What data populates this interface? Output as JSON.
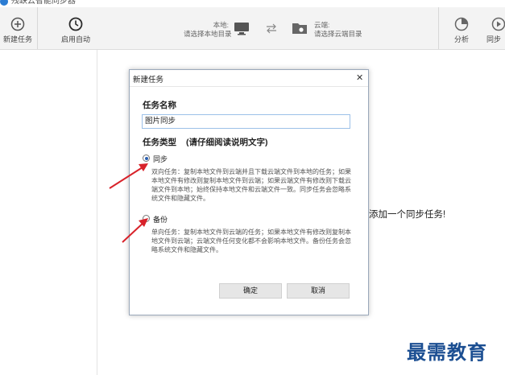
{
  "window": {
    "title": "残缺云智能同步器"
  },
  "toolbar": {
    "new_task_label": "新建任务",
    "autostart_label": "启用自动",
    "local_label": "本地:",
    "local_placeholder": "请选择本地目录",
    "cloud_label": "云端:",
    "cloud_placeholder": "请选择云端目录",
    "analyze_label": "分析",
    "sync_label": "同步"
  },
  "main": {
    "empty_hint": "添加一个同步任务!"
  },
  "dialog": {
    "title": "新建任务",
    "task_name_heading": "任务名称",
    "task_name_value": "图片同步",
    "task_type_heading": "任务类型",
    "task_type_note": "(请仔细阅读说明文字)",
    "options": [
      {
        "label": "同步",
        "selected": true,
        "description": "双向任务：复制本地文件到云端并且下载云端文件到本地的任务；如果本地文件有修改则复制本地文件到云端；如果云端文件有修改则下载云端文件到本地；始终保持本地文件和云端文件一致。同步任务会忽略系统文件和隐藏文件。"
      },
      {
        "label": "备份",
        "selected": false,
        "description": "单向任务：复制本地文件到云端的任务；如果本地文件有修改则复制本地文件到云端；云端文件任何变化都不会影响本地文件。备份任务会忽略系统文件和隐藏文件。"
      }
    ],
    "ok_label": "确定",
    "cancel_label": "取消"
  },
  "watermark": "最需教育",
  "colors": {
    "arrow": "#d8222a",
    "accent": "#2a5fb0",
    "watermark": "#1c4f92"
  }
}
